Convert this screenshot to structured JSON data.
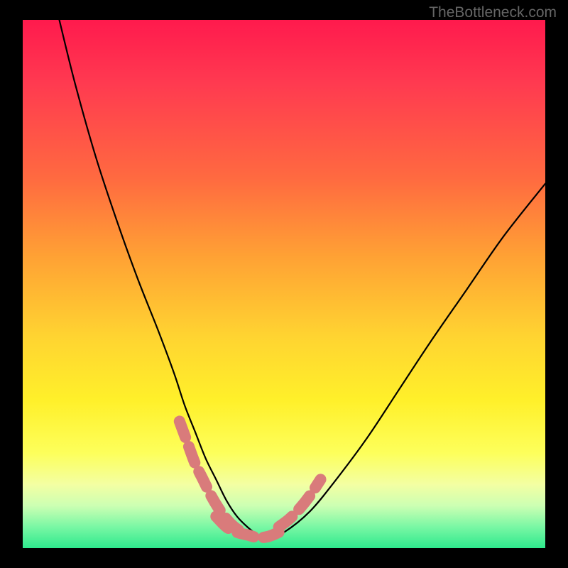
{
  "watermark": "TheBottleneck.com",
  "chart_data": {
    "type": "line",
    "title": "",
    "xlabel": "",
    "ylabel": "",
    "xlim": [
      0,
      100
    ],
    "ylim": [
      0,
      100
    ],
    "series": [
      {
        "name": "bottleneck-curve",
        "x": [
          7,
          10,
          14,
          18,
          22,
          26,
          29,
          31,
          33,
          35,
          37,
          39,
          41,
          43,
          45,
          47,
          50,
          55,
          60,
          66,
          72,
          78,
          85,
          92,
          100
        ],
        "values": [
          100,
          88,
          74,
          62,
          51,
          41,
          33,
          27,
          22,
          17,
          13,
          9,
          6,
          4,
          2.5,
          2,
          3,
          7,
          13,
          21,
          30,
          39,
          49,
          59,
          69
        ]
      },
      {
        "name": "curve-highlight-left",
        "x": [
          30,
          31.5,
          33,
          34.5,
          36,
          37.5,
          39,
          40.5,
          42
        ],
        "values": [
          24,
          20,
          16,
          13,
          10,
          7.5,
          5.5,
          4,
          3
        ]
      },
      {
        "name": "curve-highlight-bottom",
        "x": [
          37,
          39,
          41,
          43,
          45,
          47,
          49
        ],
        "values": [
          6,
          4,
          3,
          2.5,
          2,
          2.2,
          3
        ]
      },
      {
        "name": "curve-highlight-right",
        "x": [
          49,
          51,
          53,
          55,
          57
        ],
        "values": [
          4,
          5.5,
          7.5,
          10,
          13
        ]
      }
    ],
    "colors": {
      "curve": "#000000",
      "highlight": "#d97b7b",
      "gradient_top": "#ff1a4d",
      "gradient_bottom": "#2ee98d"
    }
  }
}
